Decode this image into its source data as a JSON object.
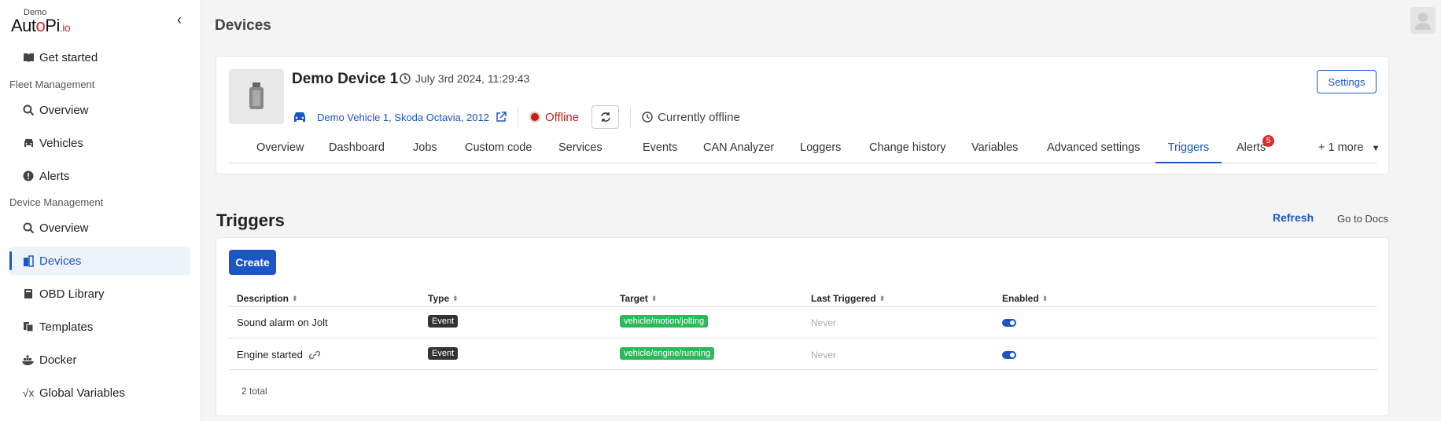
{
  "brand": {
    "demo": "Demo",
    "name_a": "Aut",
    "name_b": "o",
    "name_c": "Pi",
    "name_d": ".io"
  },
  "sidebar": {
    "top_item": "Get started",
    "fleet_section": "Fleet Management",
    "fleet_items": [
      "Overview",
      "Vehicles",
      "Alerts"
    ],
    "device_section": "Device Management",
    "device_items": [
      "Overview",
      "Devices",
      "OBD Library",
      "Templates",
      "Docker",
      "Global Variables"
    ],
    "active": "Devices"
  },
  "header": {
    "title": "Devices"
  },
  "device": {
    "name": "Demo Device 1",
    "timestamp": "July 3rd 2024, 11:29:43",
    "vehicle": "Demo Vehicle 1, Skoda Octavia, 2012",
    "status": "Offline",
    "connection": "Currently offline",
    "settings_label": "Settings"
  },
  "tabs": [
    {
      "label": "Overview"
    },
    {
      "label": "Dashboard"
    },
    {
      "label": "Jobs"
    },
    {
      "label": "Custom code"
    },
    {
      "label": "Services"
    },
    {
      "label": "Events"
    },
    {
      "label": "CAN Analyzer"
    },
    {
      "label": "Loggers"
    },
    {
      "label": "Change history"
    },
    {
      "label": "Variables"
    },
    {
      "label": "Advanced settings"
    },
    {
      "label": "Triggers"
    },
    {
      "label": "Alerts",
      "badge": "5"
    },
    {
      "label": "+ 1 more"
    }
  ],
  "active_tab": "Triggers",
  "triggers": {
    "title": "Triggers",
    "refresh_label": "Refresh",
    "docs_label": "Go to Docs",
    "create_label": "Create",
    "columns": [
      "Description",
      "Type",
      "Target",
      "Last Triggered",
      "Enabled"
    ],
    "rows": [
      {
        "description": "Sound alarm on Jolt",
        "type": "Event",
        "target": "vehicle/motion/jolting",
        "last_triggered": "Never",
        "enabled": true
      },
      {
        "description": "Engine started",
        "type": "Event",
        "target": "vehicle/engine/running",
        "last_triggered": "Never",
        "enabled": true
      }
    ],
    "total": "2 total"
  },
  "colors": {
    "accent": "#1a56c6",
    "offline": "#c0201a",
    "target_pill": "#2eb85c",
    "badge": "#d9302b"
  }
}
